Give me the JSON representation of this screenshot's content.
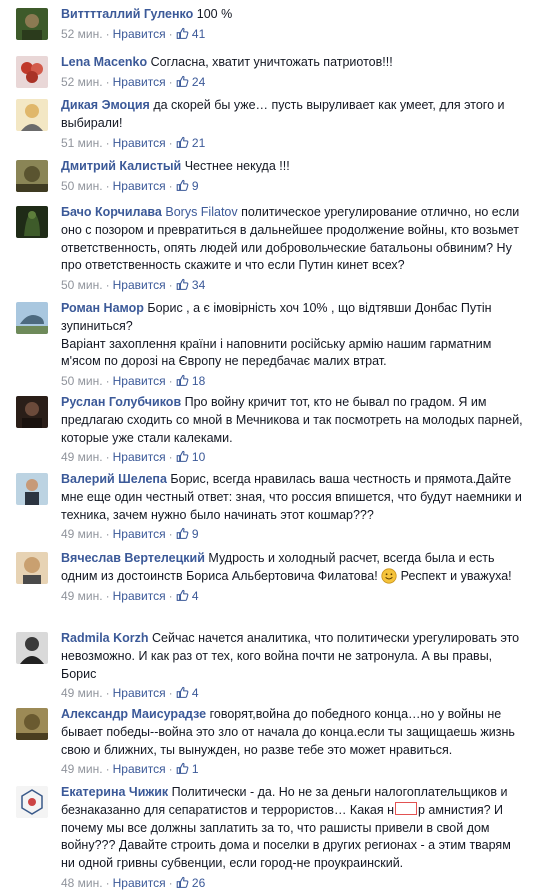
{
  "like_label": "Нравится",
  "comments": [
    {
      "author": "Витттталлий Гуленко",
      "text": "100 %",
      "time": "52 мин.",
      "likes": "41",
      "avatar_color": "#3d5a2a"
    },
    {
      "author": "Lena Macenko",
      "text": "Согласна, хватит уничтожать патриотов!!!",
      "time": "52 мин.",
      "likes": "24",
      "avatar_color": "#c0392b"
    },
    {
      "author": "Дикая Эмоция",
      "text": "да скорей бы уже… пусть выруливает как умеет, для этого и выбирали!",
      "time": "51 мин.",
      "likes": "21",
      "avatar_color": "#e8c66a"
    },
    {
      "author": "Дмитрий Калистый",
      "text": "Честнее некуда !!!",
      "time": "50 мин.",
      "likes": "9",
      "avatar_color": "#6b6a3a"
    },
    {
      "author": "Бачо Корчилава",
      "mention": "Borys Filatov",
      "text": "политическое урегулирование отлично, но если оно с позором и превратиться в дальнейшее продолжение войны, кто возьмет ответственность, опять людей или добровольческие батальоны обвиним? Ну про ответственность скажите и что если Путин кинет всех?",
      "time": "50 мин.",
      "likes": "34",
      "avatar_color": "#2f4a1e"
    },
    {
      "author": "Роман Намор",
      "text": "Борис , а є імовірність хоч 10% , що відтявши Донбас Путін зупиниться?",
      "text2": "Варіант захоплення країни і наповнити російську армію нашим гарматним м'ясом по дорозі на Європу не передбачає малих втрат.",
      "time": "50 мин.",
      "likes": "18",
      "avatar_color": "#7fa7c9"
    },
    {
      "author": "Руслан Голубчиков",
      "text": "Про войну кричит тот, кто не бывал по градом. Я им предлагаю сходить со мной в Мечникова и так посмотреть на молодых парней, которые уже стали калеками.",
      "time": "49 мин.",
      "likes": "10",
      "avatar_color": "#3a2a22"
    },
    {
      "author": "Валерий Шелепа",
      "text": "Борис, всегда нравилась ваша честность и прямота.Дайте мне еще один честный ответ: зная, что россия впишется, что будут наемники и техника, зачем нужно было начинать этот кошмар???",
      "time": "49 мин.",
      "likes": "9",
      "avatar_color": "#8aa6b8"
    },
    {
      "author": "Вячеслав Вертелецкий",
      "text": "Мудрость и холодный расчет, всегда была и есть одним из достоинств Бориса Альбертовича Филатова!",
      "text_after": "Респект и уважуха!",
      "time": "49 мин.",
      "likes": "4",
      "avatar_color": "#c9a070"
    },
    {
      "author": "Radmila Korzh",
      "text": "Сейчас начется аналитика, что политически урегулировать это невозможно. И как раз от тех, кого война почти не затронула. А вы правы, Борис",
      "time": "49 мин.",
      "likes": "4",
      "avatar_color": "#555555"
    },
    {
      "author": "Александр Маисурадзе",
      "text": "говорят,война до победного конца…но у войны не бывает победы--война это зло от начала до конца.если ты защищаешь жизнь свою и ближних, ты вынужден, но разве тебе это может нравиться.",
      "time": "49 мин.",
      "likes": "1",
      "avatar_color": "#7a6a40"
    },
    {
      "author": "Екатерина Чижик",
      "text": "Политически - да. Но не за деньги налогоплательщиков и безнаказанно для сепаратистов и террористов… Какая н",
      "text_redact_after": "р амнистия? И почему мы все должны заплатить за то, что рашисты привели в свой дом войну??? Давайте строить дома и поселки в других регионах - а этим тварям ни одной гривны субвенции, если город-не проукраинский.",
      "time": "48 мин.",
      "likes": "26",
      "avatar_color": "#d8d8d8"
    }
  ]
}
